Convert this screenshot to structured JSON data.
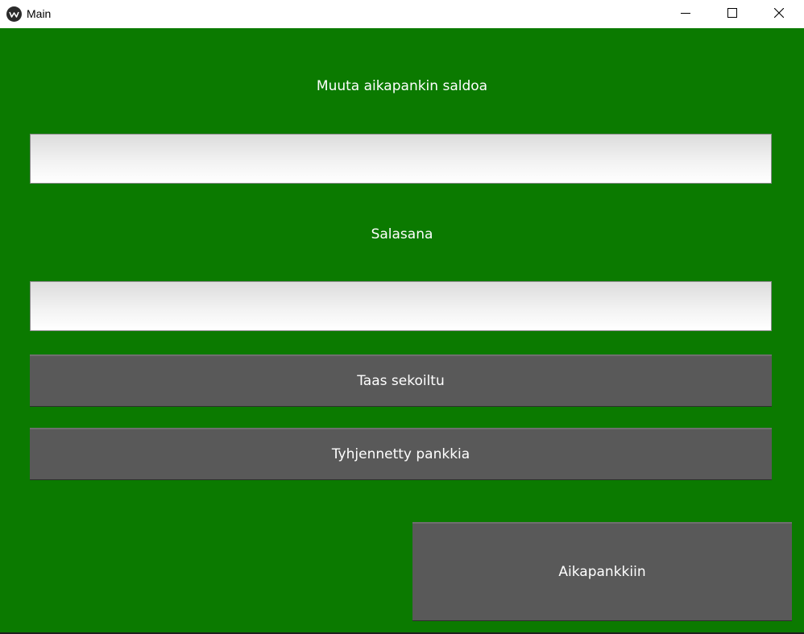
{
  "window": {
    "title": "Main",
    "app_icon": "kivy-logo-icon",
    "controls": [
      "minimize-icon",
      "maximize-icon",
      "close-icon"
    ]
  },
  "form": {
    "balance_label": "Muuta aikapankin saldoa",
    "balance_value": "",
    "password_label": "Salasana",
    "password_value": "",
    "shuffle_button": "Taas sekoiltu",
    "clear_button": "Tyhjennetty pankkia",
    "to_bank_button": "Aikapankkiin"
  },
  "colors": {
    "background": "#0b7a00",
    "button": "#595959",
    "text": "#ffffff"
  }
}
